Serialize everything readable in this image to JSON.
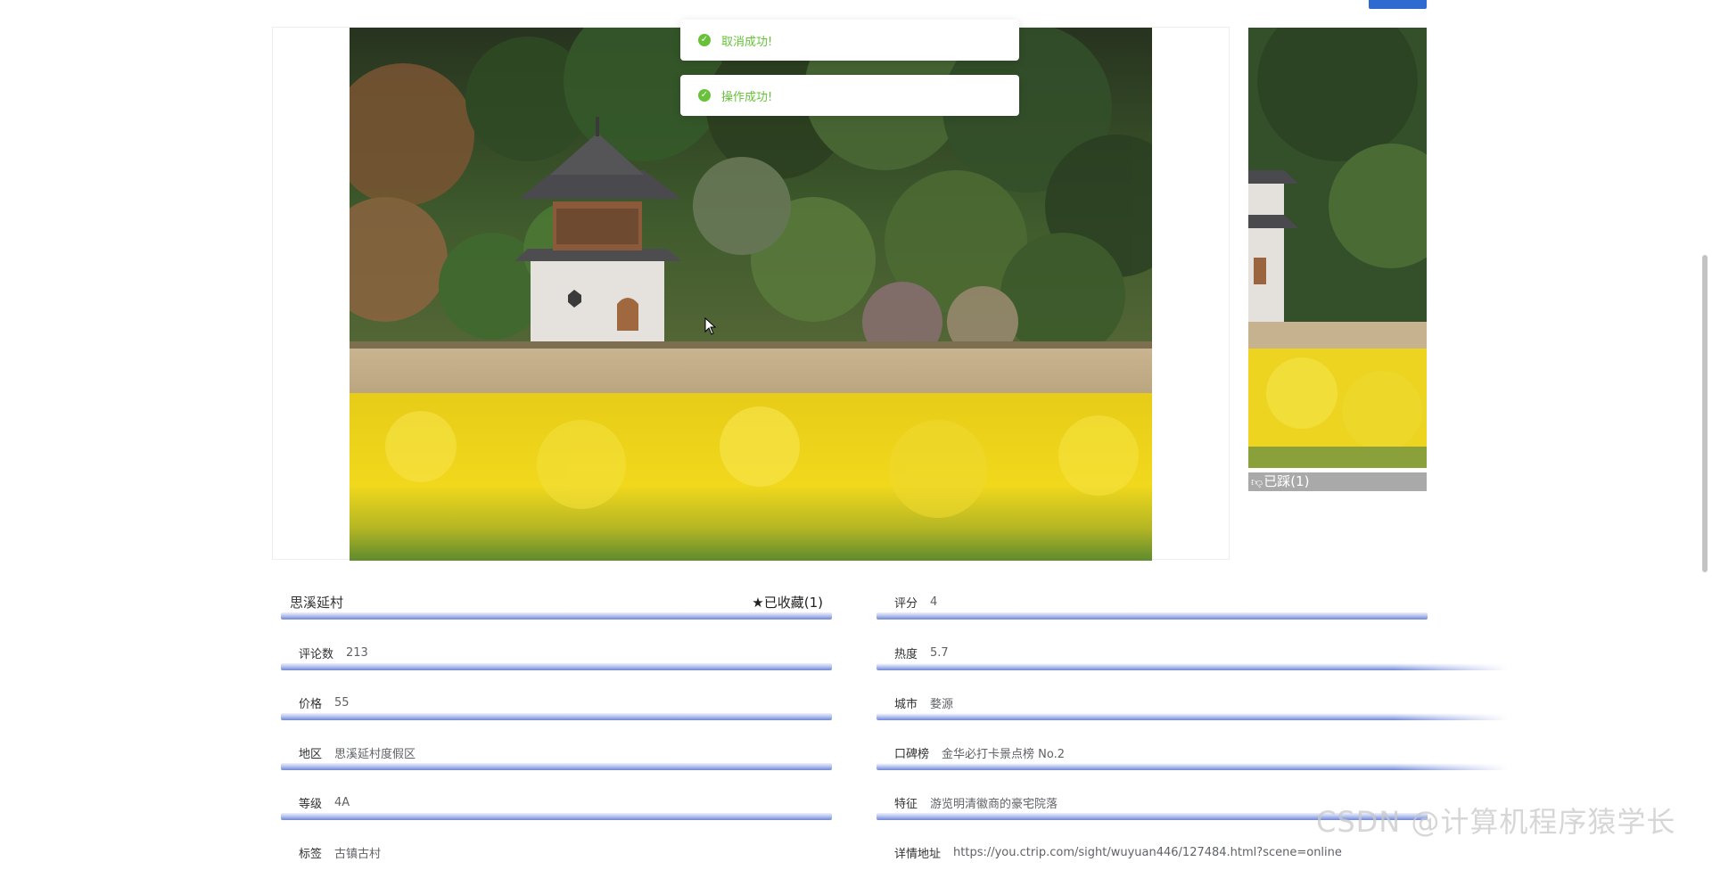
{
  "header": {
    "corner_button_label": ""
  },
  "toasts": [
    {
      "text": "取消成功!"
    },
    {
      "text": "操作成功!"
    }
  ],
  "main_image": {
    "description_icon": "photo"
  },
  "thumbnail": {
    "caption_icon": "thumb-down-icon",
    "caption": "已踩(1)"
  },
  "info": {
    "name": "思溪延村",
    "favorite_label": "已收藏(1)",
    "favorite_icon": "star-icon",
    "left": [
      {
        "label": "评论数",
        "value": "213"
      },
      {
        "label": "价格",
        "value": "55"
      },
      {
        "label": "地区",
        "value": "思溪延村度假区"
      },
      {
        "label": "等级",
        "value": "4A"
      },
      {
        "label": "标签",
        "value": "古镇古村"
      }
    ],
    "right": [
      {
        "label": "评分",
        "value": "4"
      },
      {
        "label": "热度",
        "value": "5.7"
      },
      {
        "label": "城市",
        "value": "婺源"
      },
      {
        "label": "口碑榜",
        "value": "金华必打卡景点榜 No.2"
      },
      {
        "label": "特征",
        "value": "游览明清徽商的豪宅院落"
      },
      {
        "label": "详情地址",
        "value": "https://you.ctrip.com/sight/wuyuan446/127484.html?scene=online"
      }
    ]
  },
  "watermark": "CSDN @计算机程序猿学长",
  "colors": {
    "toast_success": "#67c23a",
    "accent": "#2f6ad0",
    "row_bar": "#6f86d6"
  }
}
